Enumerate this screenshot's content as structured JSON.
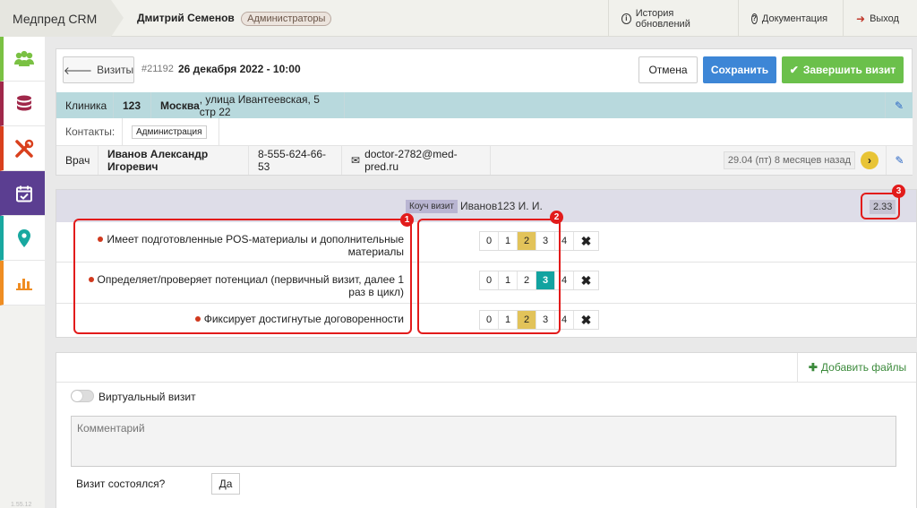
{
  "app": {
    "brand": "Медпред CRM",
    "user": "Дмитрий Семенов",
    "role": "Администраторы"
  },
  "topnav": {
    "history": "История обновлений",
    "docs": "Документация",
    "exit": "Выход"
  },
  "sidebar": {
    "version": "1.55.12",
    "items": [
      {
        "name": "users",
        "color": "#7ac143"
      },
      {
        "name": "database",
        "color": "#a0284a"
      },
      {
        "name": "tools",
        "color": "#d9401d"
      },
      {
        "name": "calendar",
        "color": "#5b3e91"
      },
      {
        "name": "map-pin",
        "color": "#18a8a0"
      },
      {
        "name": "chart",
        "color": "#ef8d22"
      }
    ]
  },
  "visit": {
    "back_label": "Визиты",
    "id": "#21192",
    "date": "26 декабря 2022 - 10:00",
    "cancel": "Отмена",
    "save": "Сохранить",
    "finish": "Завершить визит"
  },
  "clinic": {
    "label": "Клиника",
    "number": "123",
    "city": "Москва",
    "address": ", улица Ивантеевская, 5 стр 22"
  },
  "contacts": {
    "label": "Контакты:",
    "tag": "Администрация"
  },
  "doctor": {
    "label": "Врач",
    "name": "Иванов Александр Игоревич",
    "phone": "8-555-624-66-53",
    "email": "doctor-2782@med-pred.ru",
    "last_visit": "29.04 (пт) 8 месяцев назад"
  },
  "coach": {
    "badge": "Коуч визит",
    "person": "Иванов123 И. И.",
    "score": "2.33"
  },
  "criteria": [
    {
      "text": "Имеет подготовленные POS-материалы и дополнительные материалы",
      "selected": 2
    },
    {
      "text": "Определяет/проверяет потенциал (первичный визит, далее 1 раз в цикл)",
      "selected": 3
    },
    {
      "text": "Фиксирует достигнутые договоренности",
      "selected": 2
    }
  ],
  "rating_scale": [
    "0",
    "1",
    "2",
    "3",
    "4"
  ],
  "markers": {
    "m1": "1",
    "m2": "2",
    "m3": "3"
  },
  "form": {
    "add_files": "Добавить файлы",
    "virtual_label": "Виртуальный визит",
    "comment_placeholder": "Комментарий",
    "took_place_label": "Визит состоялся?",
    "took_place_value": "Да"
  }
}
